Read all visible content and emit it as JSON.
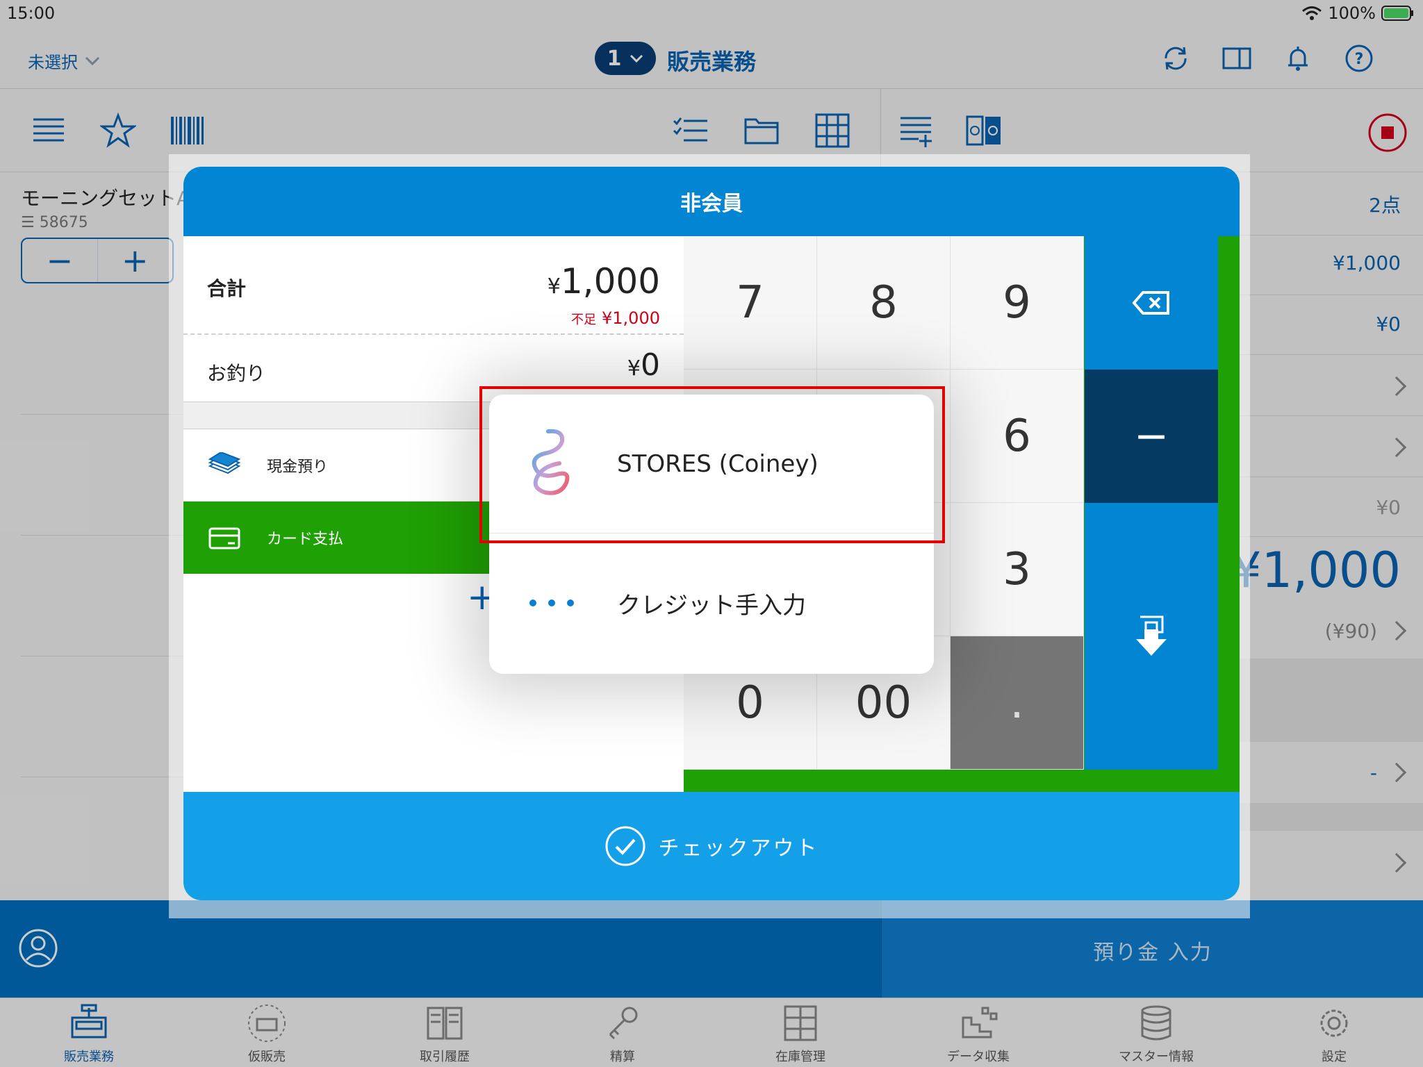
{
  "status_bar": {
    "time": "15:00",
    "battery": "100%"
  },
  "header": {
    "register_select": "未選択",
    "register_number": "1",
    "title": "販売業務"
  },
  "product": {
    "name": "モーニングセットA",
    "code": "☰ 58675",
    "minus": "−",
    "plus": "+"
  },
  "summary": {
    "count": "2点",
    "subtotal": "¥1,000",
    "discount": "¥0",
    "tax": "¥0",
    "total": "¥1,000",
    "tax_included": "(¥90)",
    "dash": "-"
  },
  "deposit_button": "預り金 入力",
  "modal": {
    "title": "非会員",
    "total_label": "合計",
    "total_yen": "¥",
    "total_value": "1,000",
    "shortage_label": "不足",
    "shortage_value": "¥1,000",
    "change_label": "お釣り",
    "change_yen": "¥",
    "change_value": "0",
    "cash_label": "現金預り",
    "card_label": "カード支払",
    "add_label": "+",
    "checkout_label": "チェックアウト"
  },
  "keypad": {
    "k7": "7",
    "k8": "8",
    "k9": "9",
    "k6": "6",
    "k3": "3",
    "k0": "0",
    "k00": "00",
    "kdot": ".",
    "minus": "−"
  },
  "popover": {
    "stores_label": "STORES (Coiney)",
    "manual_label": "クレジット手入力"
  },
  "tabs": [
    {
      "label": "販売業務"
    },
    {
      "label": "仮販売"
    },
    {
      "label": "取引履歴"
    },
    {
      "label": "精算"
    },
    {
      "label": "在庫管理"
    },
    {
      "label": "データ収集"
    },
    {
      "label": "マスター情報"
    },
    {
      "label": "設定"
    }
  ],
  "colors": {
    "accent": "#0b62b0",
    "modal_header": "#0285d2",
    "keypad_green": "#1fa004",
    "checkout": "#14a0e9",
    "highlight": "#e30000"
  },
  "icons": [
    "wifi-icon",
    "battery-icon",
    "chevron-down-icon",
    "sync-icon",
    "split-view-icon",
    "bell-icon",
    "help-icon",
    "list-icon",
    "star-icon",
    "barcode-icon",
    "checklist-icon",
    "folder-icon",
    "grid-icon",
    "add-line-icon",
    "stamp-icon",
    "stop-icon",
    "user-icon",
    "backspace-icon",
    "enter-icon",
    "cash-icon",
    "card-icon",
    "check-circle-icon",
    "stores-logo-icon",
    "more-icon"
  ]
}
